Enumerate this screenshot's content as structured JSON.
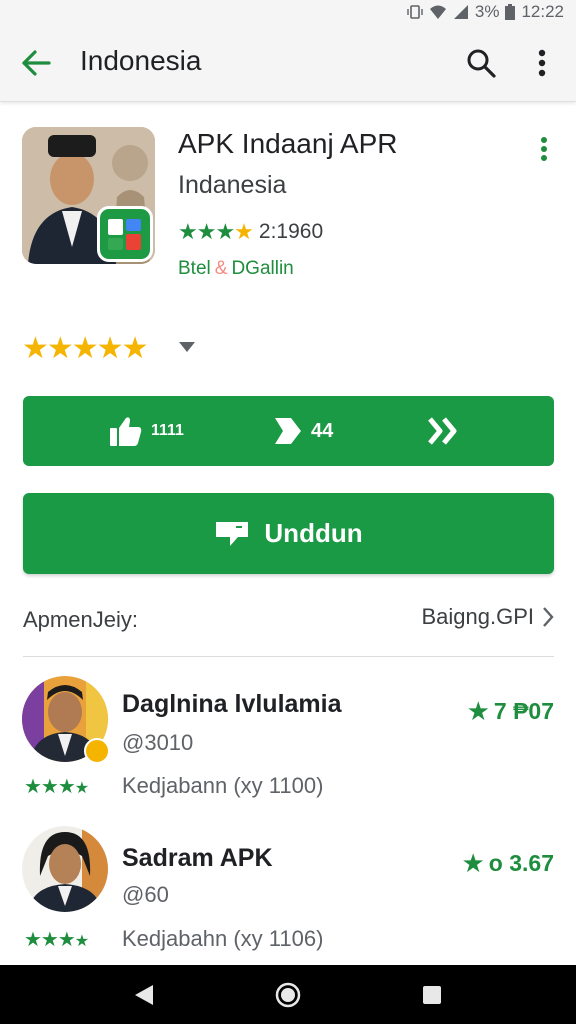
{
  "status_bar": {
    "battery_text": "3%",
    "time": "12:22"
  },
  "app_bar": {
    "title": "Indonesia"
  },
  "app": {
    "title": "APK Indaanj APR",
    "developer": "Indanesia",
    "rating_count": "2:1960",
    "tag_left": "Btel",
    "tag_sep": "&",
    "tag_right": "DGallin"
  },
  "actions": {
    "likes": "1111",
    "shares": "44"
  },
  "install": {
    "label": "Unddun"
  },
  "section": {
    "label": "ApmenJeiy:",
    "link": "Baigng.GPI"
  },
  "items": [
    {
      "name": "Daglnina lvlulamia",
      "sub": "@3010",
      "score": "7 ₱07",
      "meta": "Kedjabann (xy 1100)"
    },
    {
      "name": "Sadram APK",
      "sub": "@60",
      "score": "o 3.67",
      "meta": "Kedjabahn (xy 1106)"
    }
  ],
  "colors": {
    "accent_green": "#1a9a44",
    "star_yellow": "#f4b400",
    "app_bar_bg": "#f5f5f5"
  }
}
